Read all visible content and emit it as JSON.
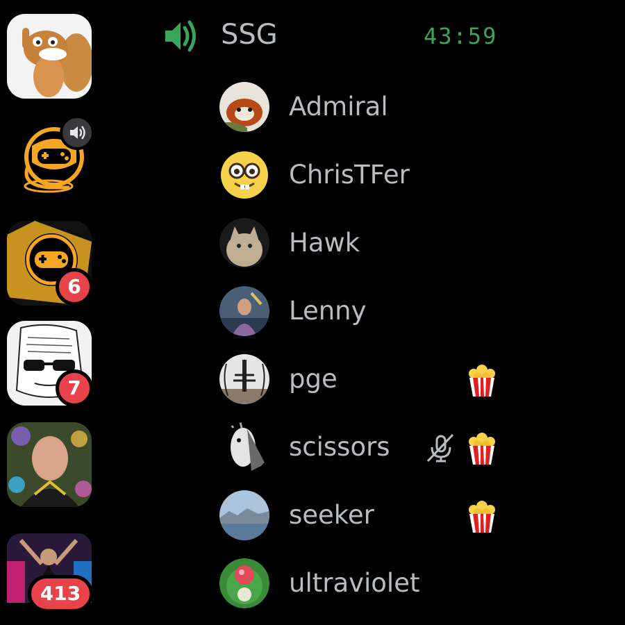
{
  "servers": [
    {
      "name": "squirrel-server",
      "badge": ""
    },
    {
      "name": "gamepad-server-speaking",
      "badge": ""
    },
    {
      "name": "gamepad-server-yellow",
      "badge": "6"
    },
    {
      "name": "sunglasses-meme-server",
      "badge": "7"
    },
    {
      "name": "selfie-server",
      "badge": ""
    },
    {
      "name": "stage-server",
      "badge": "413"
    }
  ],
  "channel": {
    "icon": "speaker-icon",
    "name": "SSG",
    "timer": "43:59",
    "accent": "#3ba55c"
  },
  "members": [
    {
      "name": "Admiral",
      "avatar": "red-panda-avatar",
      "muted": false,
      "activity": ""
    },
    {
      "name": "ChrisTFer",
      "avatar": "nerd-emoji-avatar",
      "muted": false,
      "activity": ""
    },
    {
      "name": "Hawk",
      "avatar": "cat-avatar",
      "muted": false,
      "activity": ""
    },
    {
      "name": "Lenny",
      "avatar": "photo-avatar",
      "muted": false,
      "activity": ""
    },
    {
      "name": "pge",
      "avatar": "tower-avatar",
      "muted": false,
      "activity": "popcorn-icon"
    },
    {
      "name": "scissors",
      "avatar": "goat-avatar",
      "muted": true,
      "activity": "popcorn-icon"
    },
    {
      "name": "seeker",
      "avatar": "landscape-avatar",
      "muted": false,
      "activity": "popcorn-icon"
    },
    {
      "name": "ultraviolet",
      "avatar": "gem-avatar",
      "muted": false,
      "activity": ""
    }
  ],
  "colors": {
    "badge": "#e8434a",
    "text": "#b9bcc0",
    "speaking": "#3ba55c"
  }
}
